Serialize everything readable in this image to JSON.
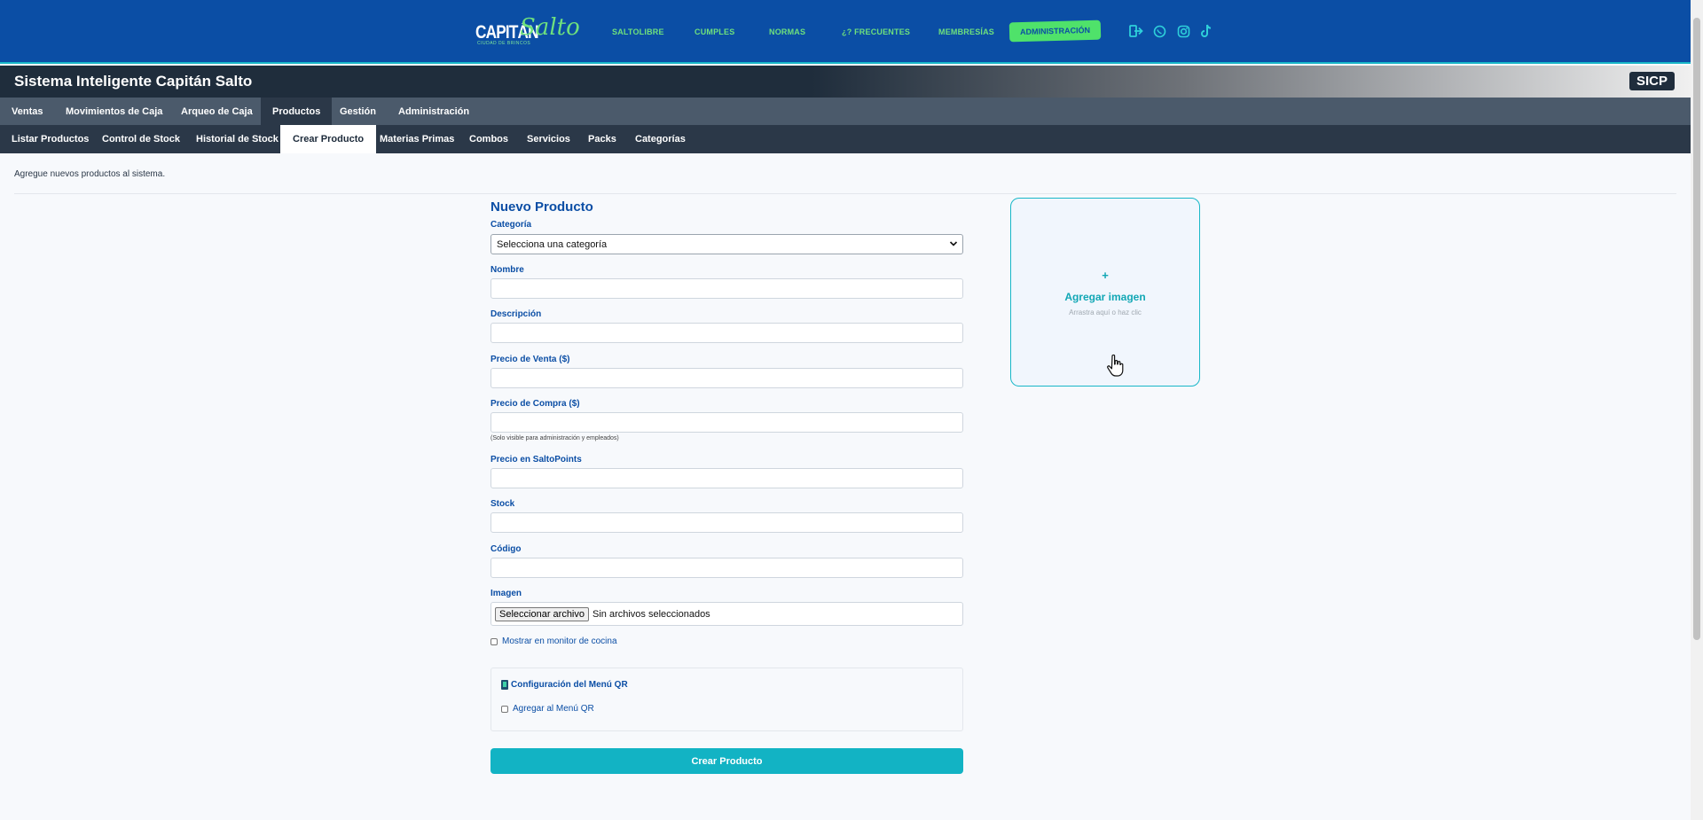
{
  "header": {
    "logo": {
      "word1": "CAPITÁN",
      "word2": "Salto",
      "tagline": "CIUDAD DE BRINCOS"
    },
    "nav": [
      "SALTOLIBRE",
      "CUMPLES",
      "NORMAS",
      "¿? FRECUENTES",
      "MEMBRESÍAS"
    ],
    "admin_label": "ADMINISTRACIÓN",
    "social_icons": [
      "logout-icon",
      "whatsapp-icon",
      "instagram-icon",
      "tiktok-icon"
    ],
    "colors": {
      "bg": "#0b4ea5",
      "link": "#6ee07d",
      "admin_bg": "#4fe26a",
      "icon": "#2ed0da"
    }
  },
  "titlebar": {
    "title": "Sistema Inteligente Capitán Salto",
    "badge": "SICP"
  },
  "main_tabs": [
    "Ventas",
    "Movimientos de Caja",
    "Arqueo de Caja",
    "Productos",
    "Gestión",
    "Administración"
  ],
  "main_tab_active": "Productos",
  "sub_tabs": [
    "Listar Productos",
    "Control de Stock",
    "Historial de Stock",
    "Crear Producto",
    "Materias Primas",
    "Combos",
    "Servicios",
    "Packs",
    "Categorías"
  ],
  "sub_tab_active": "Crear Producto",
  "intro": "Agregue nuevos productos al sistema.",
  "form": {
    "title": "Nuevo Producto",
    "category_label": "Categoría",
    "category_value": "Selecciona una categoría",
    "name_label": "Nombre",
    "description_label": "Descripción",
    "sale_price_label": "Precio de Venta ($)",
    "purchase_price_label": "Precio de Compra ($)",
    "purchase_price_hint": "(Solo visible para administración y empleados)",
    "saltopoints_label": "Precio en SaltoPoints",
    "stock_label": "Stock",
    "code_label": "Código",
    "image_label": "Imagen",
    "file_button": "Seleccionar archivo",
    "file_status": "Sin archivos seleccionados",
    "kitchen_label": "Mostrar en monitor de cocina",
    "qr_title": "Configuración del Menú QR",
    "qr_add_label": "Agregar al Menú QR",
    "submit": "Crear Producto"
  },
  "upload": {
    "plus": "+",
    "title": "Agregar imagen",
    "subtitle": "Arrastra aquí o haz clic"
  }
}
